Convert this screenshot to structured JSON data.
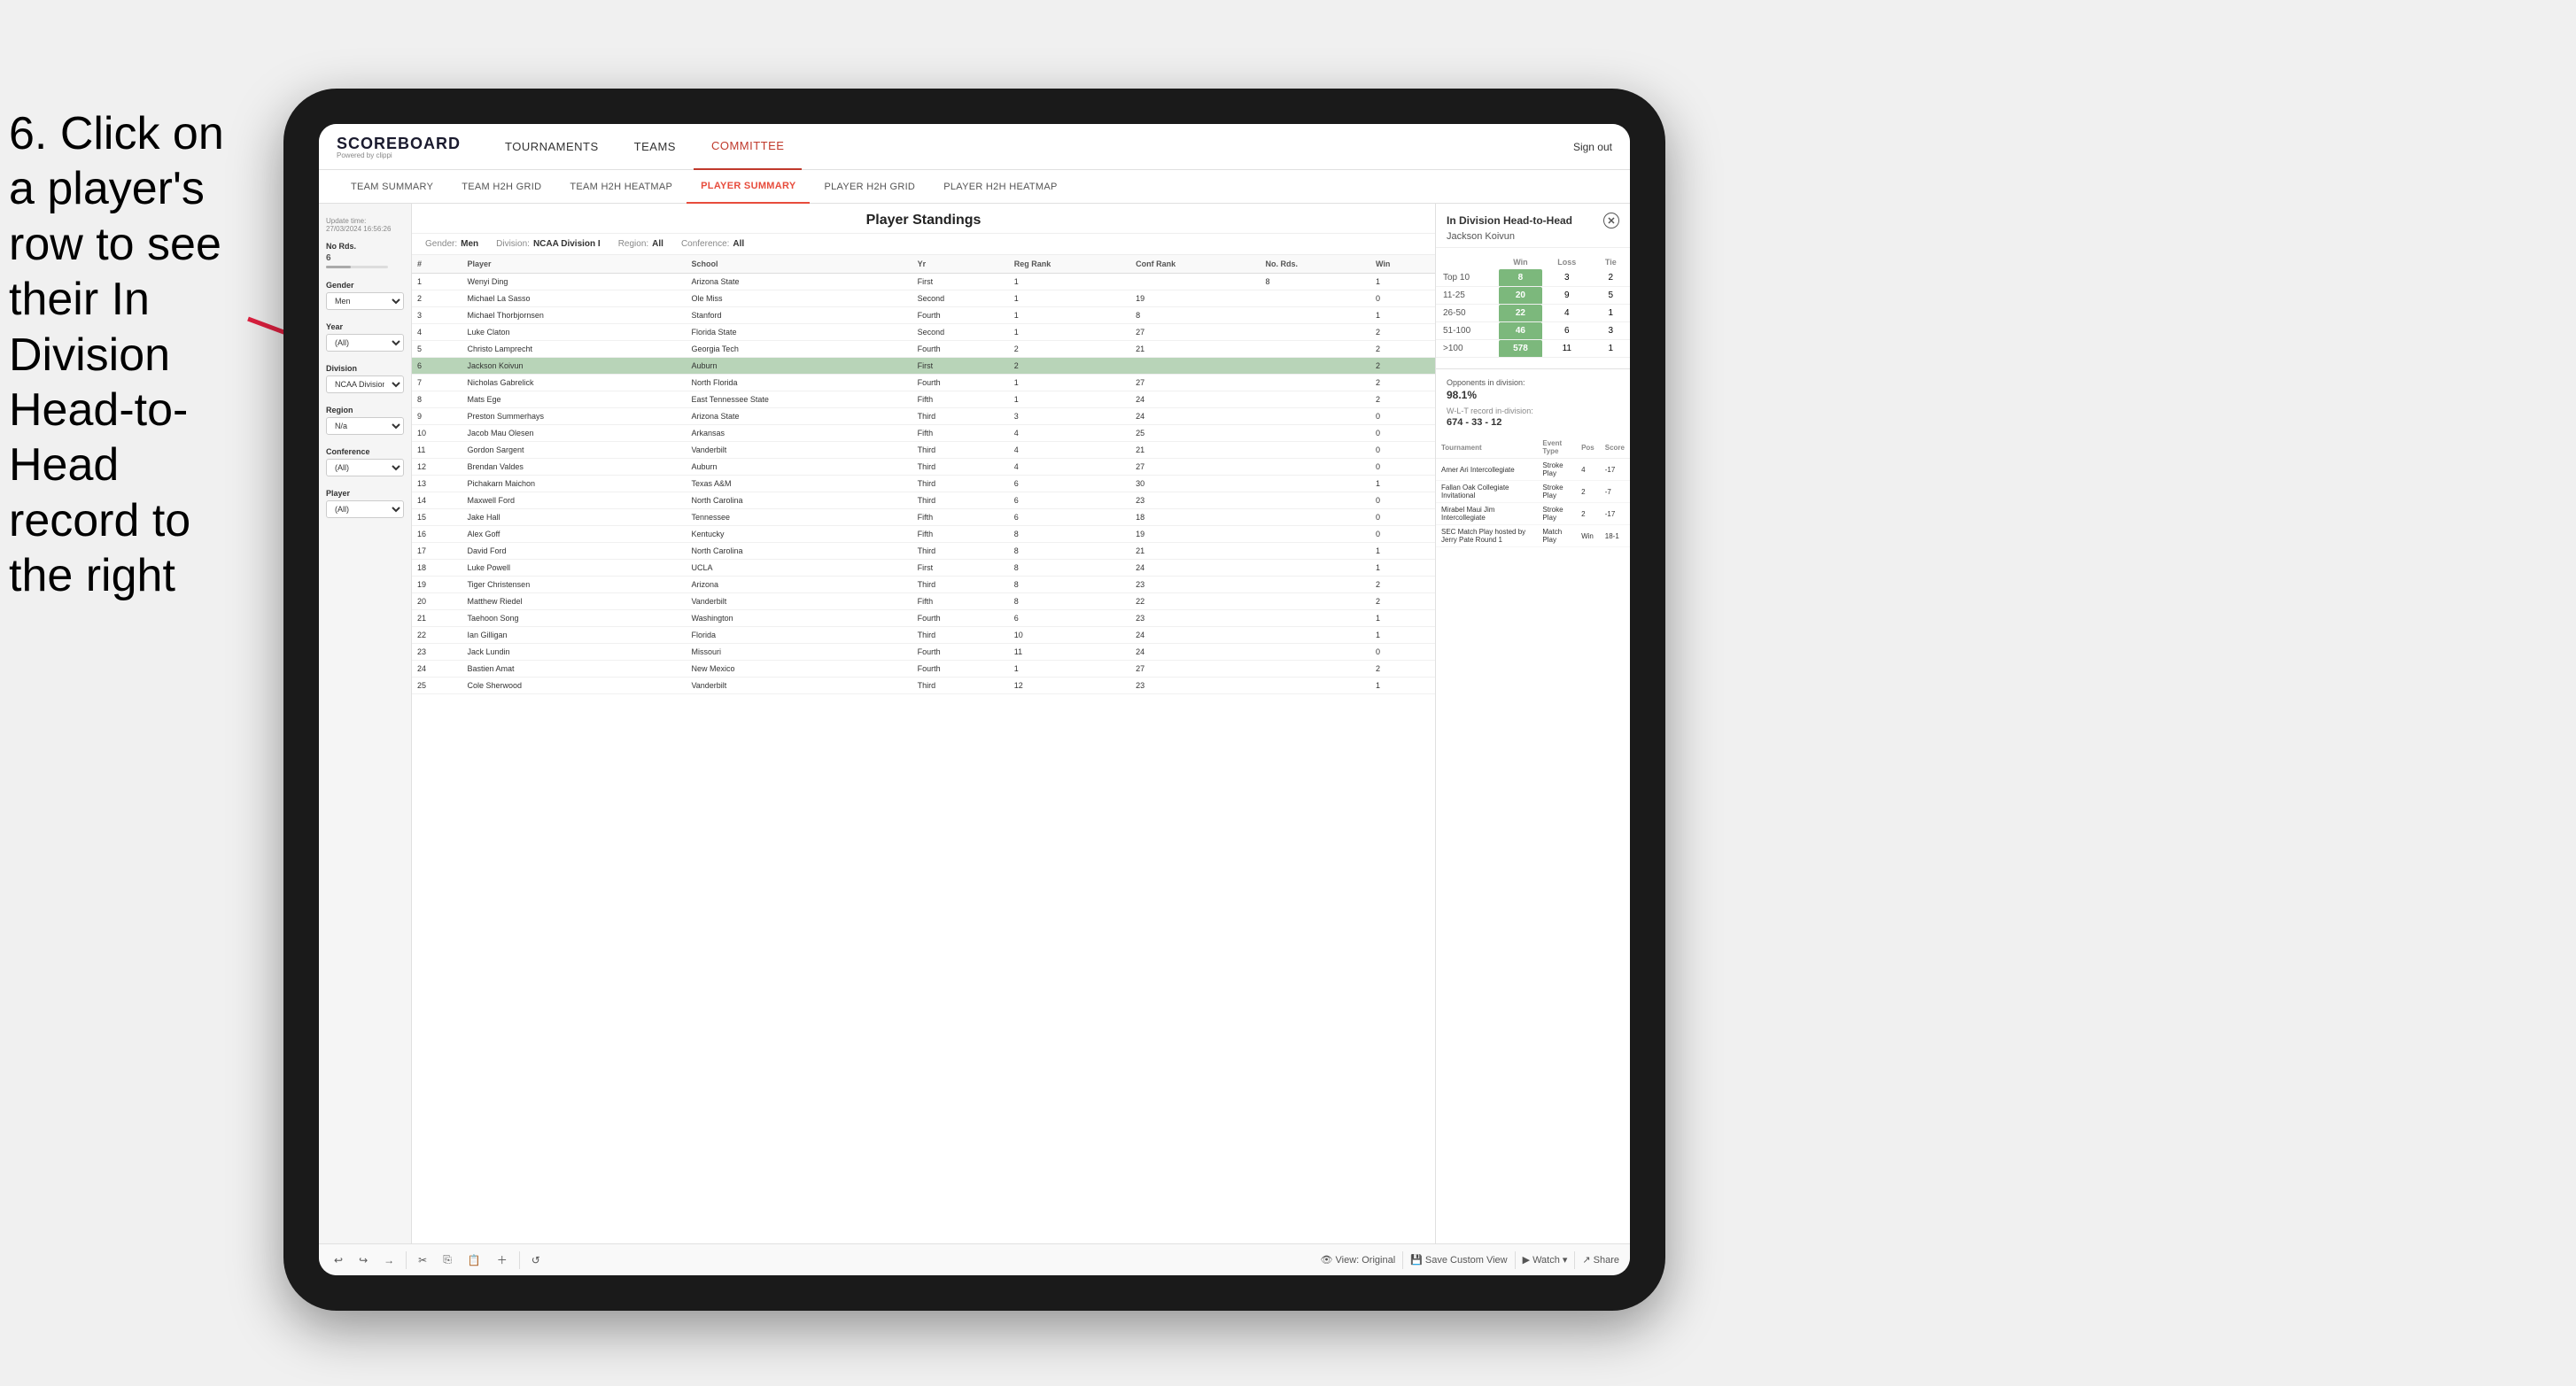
{
  "instruction": {
    "text": "6. Click on a player's row to see their In Division Head-to-Head record to the right"
  },
  "nav": {
    "logo": "SCOREBOARD",
    "logo_sub": "Powered by clippi",
    "items": [
      "TOURNAMENTS",
      "TEAMS",
      "COMMITTEE"
    ],
    "active_nav": "COMMITTEE",
    "sign_out": "Sign out"
  },
  "sub_nav": {
    "items": [
      "TEAM SUMMARY",
      "TEAM H2H GRID",
      "TEAM H2H HEATMAP",
      "PLAYER SUMMARY",
      "PLAYER H2H GRID",
      "PLAYER H2H HEATMAP"
    ],
    "active": "PLAYER SUMMARY"
  },
  "sidebar": {
    "update_label": "Update time:",
    "update_time": "27/03/2024 16:56:26",
    "no_rds_label": "No Rds.",
    "no_rds_value": "6",
    "gender_label": "Gender",
    "gender_value": "Men",
    "year_label": "Year",
    "year_value": "(All)",
    "division_label": "Division",
    "division_value": "NCAA Division I",
    "region_label": "Region",
    "region_value": "N/a",
    "conference_label": "Conference",
    "conference_value": "(All)",
    "player_label": "Player",
    "player_value": "(All)"
  },
  "player_standings": {
    "title": "Player Standings",
    "filters": {
      "gender_label": "Gender:",
      "gender_value": "Men",
      "division_label": "Division:",
      "division_value": "NCAA Division I",
      "region_label": "Region:",
      "region_value": "All",
      "conference_label": "Conference:",
      "conference_value": "All"
    },
    "columns": [
      "#",
      "Player",
      "School",
      "Yr",
      "Reg Rank",
      "Conf Rank",
      "No. Rds.",
      "Win"
    ],
    "rows": [
      {
        "rank": "1",
        "player": "Wenyi Ding",
        "school": "Arizona State",
        "yr": "First",
        "reg_rank": "1",
        "conf_rank": "",
        "no_rds": "8",
        "win": "1"
      },
      {
        "rank": "2",
        "player": "Michael La Sasso",
        "school": "Ole Miss",
        "yr": "Second",
        "reg_rank": "1",
        "conf_rank": "19",
        "no_rds": "",
        "win": "0"
      },
      {
        "rank": "3",
        "player": "Michael Thorbjornsen",
        "school": "Stanford",
        "yr": "Fourth",
        "reg_rank": "1",
        "conf_rank": "8",
        "no_rds": "",
        "win": "1"
      },
      {
        "rank": "4",
        "player": "Luke Claton",
        "school": "Florida State",
        "yr": "Second",
        "reg_rank": "1",
        "conf_rank": "27",
        "no_rds": "",
        "win": "2"
      },
      {
        "rank": "5",
        "player": "Christo Lamprecht",
        "school": "Georgia Tech",
        "yr": "Fourth",
        "reg_rank": "2",
        "conf_rank": "21",
        "no_rds": "",
        "win": "2"
      },
      {
        "rank": "6",
        "player": "Jackson Koivun",
        "school": "Auburn",
        "yr": "First",
        "reg_rank": "2",
        "conf_rank": "",
        "no_rds": "",
        "win": "2",
        "highlighted": true
      },
      {
        "rank": "7",
        "player": "Nicholas Gabrelick",
        "school": "North Florida",
        "yr": "Fourth",
        "reg_rank": "1",
        "conf_rank": "27",
        "no_rds": "",
        "win": "2"
      },
      {
        "rank": "8",
        "player": "Mats Ege",
        "school": "East Tennessee State",
        "yr": "Fifth",
        "reg_rank": "1",
        "conf_rank": "24",
        "no_rds": "",
        "win": "2"
      },
      {
        "rank": "9",
        "player": "Preston Summerhays",
        "school": "Arizona State",
        "yr": "Third",
        "reg_rank": "3",
        "conf_rank": "24",
        "no_rds": "",
        "win": "0"
      },
      {
        "rank": "10",
        "player": "Jacob Mau Olesen",
        "school": "Arkansas",
        "yr": "Fifth",
        "reg_rank": "4",
        "conf_rank": "25",
        "no_rds": "",
        "win": "0"
      },
      {
        "rank": "11",
        "player": "Gordon Sargent",
        "school": "Vanderbilt",
        "yr": "Third",
        "reg_rank": "4",
        "conf_rank": "21",
        "no_rds": "",
        "win": "0"
      },
      {
        "rank": "12",
        "player": "Brendan Valdes",
        "school": "Auburn",
        "yr": "Third",
        "reg_rank": "4",
        "conf_rank": "27",
        "no_rds": "",
        "win": "0"
      },
      {
        "rank": "13",
        "player": "Pichakarn Maichon",
        "school": "Texas A&M",
        "yr": "Third",
        "reg_rank": "6",
        "conf_rank": "30",
        "no_rds": "",
        "win": "1"
      },
      {
        "rank": "14",
        "player": "Maxwell Ford",
        "school": "North Carolina",
        "yr": "Third",
        "reg_rank": "6",
        "conf_rank": "23",
        "no_rds": "",
        "win": "0"
      },
      {
        "rank": "15",
        "player": "Jake Hall",
        "school": "Tennessee",
        "yr": "Fifth",
        "reg_rank": "6",
        "conf_rank": "18",
        "no_rds": "",
        "win": "0"
      },
      {
        "rank": "16",
        "player": "Alex Goff",
        "school": "Kentucky",
        "yr": "Fifth",
        "reg_rank": "8",
        "conf_rank": "19",
        "no_rds": "",
        "win": "0"
      },
      {
        "rank": "17",
        "player": "David Ford",
        "school": "North Carolina",
        "yr": "Third",
        "reg_rank": "8",
        "conf_rank": "21",
        "no_rds": "",
        "win": "1"
      },
      {
        "rank": "18",
        "player": "Luke Powell",
        "school": "UCLA",
        "yr": "First",
        "reg_rank": "8",
        "conf_rank": "24",
        "no_rds": "",
        "win": "1"
      },
      {
        "rank": "19",
        "player": "Tiger Christensen",
        "school": "Arizona",
        "yr": "Third",
        "reg_rank": "8",
        "conf_rank": "23",
        "no_rds": "",
        "win": "2"
      },
      {
        "rank": "20",
        "player": "Matthew Riedel",
        "school": "Vanderbilt",
        "yr": "Fifth",
        "reg_rank": "8",
        "conf_rank": "22",
        "no_rds": "",
        "win": "2"
      },
      {
        "rank": "21",
        "player": "Taehoon Song",
        "school": "Washington",
        "yr": "Fourth",
        "reg_rank": "6",
        "conf_rank": "23",
        "no_rds": "",
        "win": "1"
      },
      {
        "rank": "22",
        "player": "Ian Gilligan",
        "school": "Florida",
        "yr": "Third",
        "reg_rank": "10",
        "conf_rank": "24",
        "no_rds": "",
        "win": "1"
      },
      {
        "rank": "23",
        "player": "Jack Lundin",
        "school": "Missouri",
        "yr": "Fourth",
        "reg_rank": "11",
        "conf_rank": "24",
        "no_rds": "",
        "win": "0"
      },
      {
        "rank": "24",
        "player": "Bastien Amat",
        "school": "New Mexico",
        "yr": "Fourth",
        "reg_rank": "1",
        "conf_rank": "27",
        "no_rds": "",
        "win": "2"
      },
      {
        "rank": "25",
        "player": "Cole Sherwood",
        "school": "Vanderbilt",
        "yr": "Third",
        "reg_rank": "12",
        "conf_rank": "23",
        "no_rds": "",
        "win": "1"
      }
    ]
  },
  "h2h_panel": {
    "title": "In Division Head-to-Head",
    "player_name": "Jackson Koivun",
    "close_label": "✕",
    "table_headers": [
      "",
      "Win",
      "Loss",
      "Tie"
    ],
    "rows": [
      {
        "range": "Top 10",
        "win": "8",
        "loss": "3",
        "tie": "2"
      },
      {
        "range": "11-25",
        "win": "20",
        "loss": "9",
        "tie": "5"
      },
      {
        "range": "26-50",
        "win": "22",
        "loss": "4",
        "tie": "1"
      },
      {
        "range": "51-100",
        "win": "46",
        "loss": "6",
        "tie": "3"
      },
      {
        "range": ">100",
        "win": "578",
        "loss": "11",
        "tie": "1"
      }
    ],
    "opponents_label": "Opponents in division:",
    "wl_label": "W-L-T record in-division:",
    "opponents_pct": "98.1%",
    "wl_record": "674 - 33 - 12",
    "tournament_headers": [
      "Tournament",
      "Event Type",
      "Pos",
      "Score"
    ],
    "tournaments": [
      {
        "name": "Amer Ari Intercollegiate",
        "type": "Stroke Play",
        "pos": "4",
        "score": "-17"
      },
      {
        "name": "Fallan Oak Collegiate Invitational",
        "type": "Stroke Play",
        "pos": "2",
        "score": "-7"
      },
      {
        "name": "Mirabel Maui Jim Intercollegiate",
        "type": "Stroke Play",
        "pos": "2",
        "score": "-17"
      },
      {
        "name": "SEC Match Play hosted by Jerry Pate Round 1",
        "type": "Match Play",
        "pos": "Win",
        "score": "18-1"
      }
    ]
  },
  "toolbar": {
    "undo": "↩",
    "redo": "↪",
    "forward": "→",
    "view_original": "View: Original",
    "save_custom": "Save Custom View",
    "watch": "Watch ▾",
    "share": "Share"
  }
}
